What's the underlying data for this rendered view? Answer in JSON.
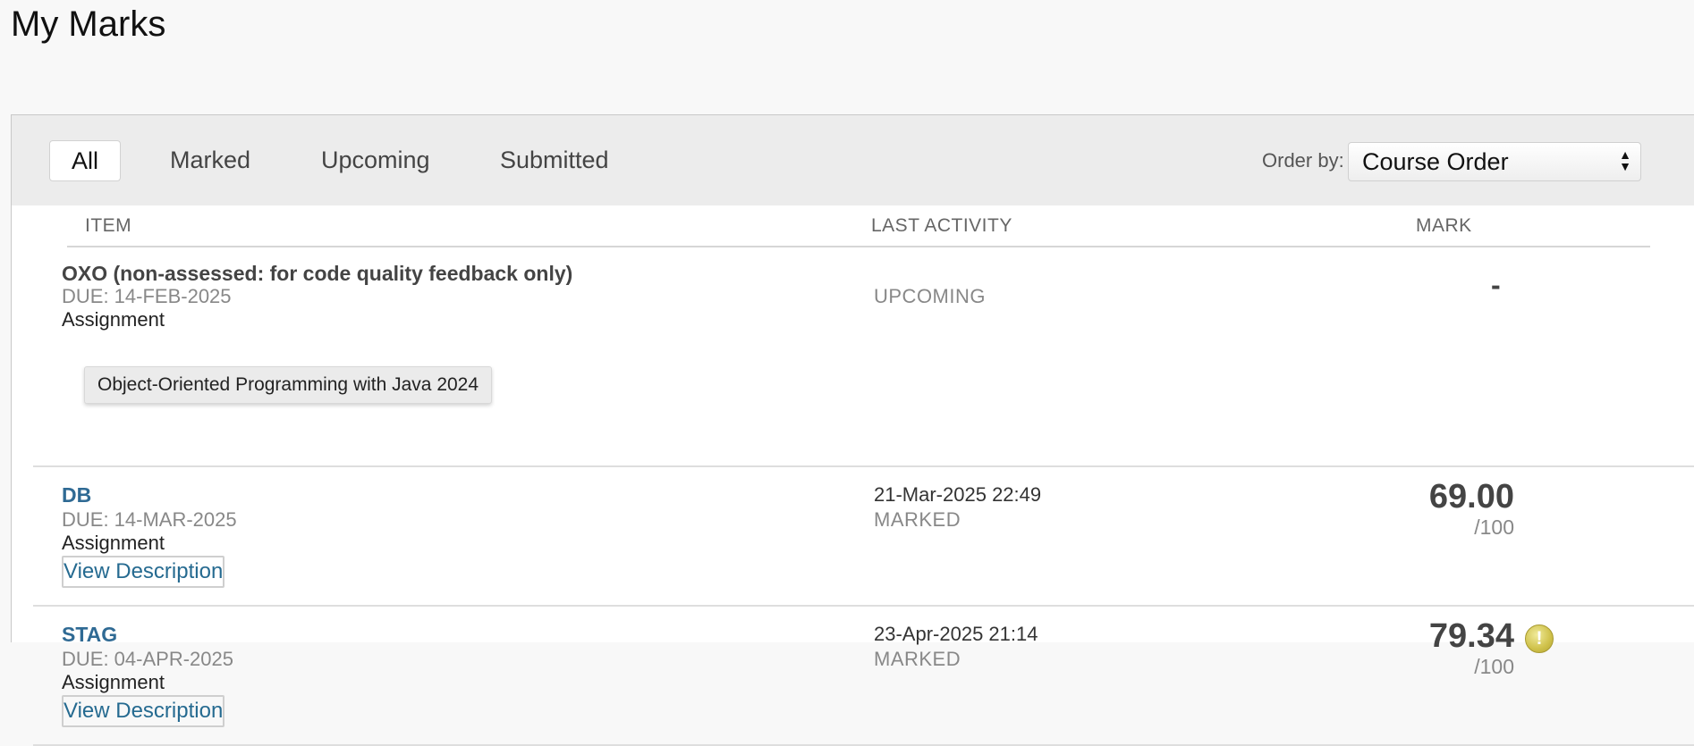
{
  "page": {
    "title": "My Marks"
  },
  "filters": {
    "tabs": [
      {
        "label": "All",
        "active": true
      },
      {
        "label": "Marked",
        "active": false
      },
      {
        "label": "Upcoming",
        "active": false
      },
      {
        "label": "Submitted",
        "active": false
      }
    ],
    "order_label": "Order by:",
    "order_value": "Course Order"
  },
  "columns": {
    "item": "ITEM",
    "last_activity": "LAST ACTIVITY",
    "mark": "MARK"
  },
  "rows": [
    {
      "title": "OXO (non-assessed: for code quality feedback only)",
      "due": "DUE: 14-FEB-2025",
      "type": "Assignment",
      "activity_status": "UPCOMING",
      "mark": "-"
    },
    {
      "title": "DB",
      "due": "DUE: 14-MAR-2025",
      "type": "Assignment",
      "view_description": "View Description",
      "activity_date": "21-Mar-2025 22:49",
      "activity_status": "MARKED",
      "mark": "69.00",
      "mark_out_of": "/100"
    },
    {
      "title": "STAG",
      "due": "DUE: 04-APR-2025",
      "type": "Assignment",
      "view_description": "View Description",
      "activity_date": "23-Apr-2025 21:14",
      "activity_status": "MARKED",
      "mark": "79.34",
      "mark_out_of": "/100",
      "icon": "exclamation-icon"
    }
  ],
  "tooltip": {
    "text": "Object-Oriented Programming with Java 2024"
  }
}
